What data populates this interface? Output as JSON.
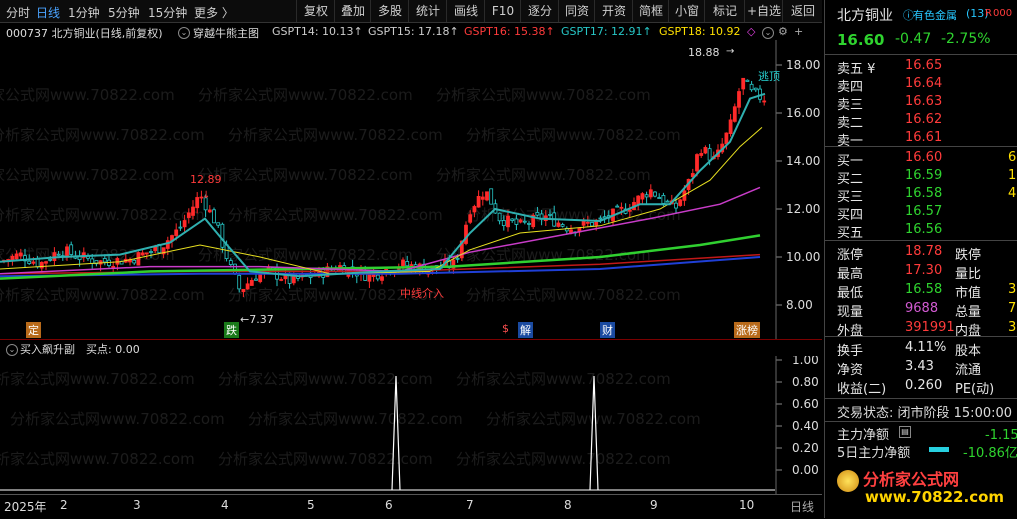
{
  "toolbar": {
    "periods": [
      "分时",
      "日线",
      "1分钟",
      "5分钟",
      "15分钟",
      "更多 〉"
    ],
    "buttons": [
      "复权",
      "叠加",
      "多股",
      "统计",
      "画线",
      "F10",
      "逐分",
      "同资",
      "开资",
      "简框",
      "小窗",
      "标记",
      "+自选",
      "返回"
    ]
  },
  "chart_header": {
    "code_name": "000737 北方铜业(日线,前复权)",
    "indicator": "穿越牛熊主图",
    "gspt": [
      {
        "label": "GSPT14: 10.13↑",
        "color": "#ff3b3b"
      },
      {
        "label": "GSPT15: 17.18↑",
        "color": "#27c7c7"
      },
      {
        "label": "GSPT16: 15.38↑",
        "color": "#ffe000"
      },
      {
        "label": "GSPT17: 12.91↑",
        "color": "#e040e0"
      },
      {
        "label": "GSPT18: 10.92",
        "color": "#2fd42f"
      }
    ]
  },
  "price_axis": {
    "ticks": [
      "18.00",
      "16.00",
      "14.00",
      "12.00",
      "10.00",
      "8.00"
    ]
  },
  "annotations": {
    "high_label": "18.88",
    "peak_label": "12.89",
    "low_label": "←7.37",
    "mid_text": "中线介入",
    "escape_text": "逃顶"
  },
  "event_markers": [
    "定",
    "跌",
    "$",
    "解",
    "财",
    "涨榜"
  ],
  "indicator_panel": {
    "name": "买入飙升副",
    "value_text": "买点: 0.00",
    "ticks": [
      "1.00",
      "0.80",
      "0.60",
      "0.40",
      "0.20",
      "0.00"
    ]
  },
  "x_axis": {
    "labels": [
      "2025年",
      "2",
      "3",
      "4",
      "5",
      "6",
      "7",
      "8",
      "9",
      "10"
    ],
    "corner": "日线"
  },
  "right_panel": {
    "stock_name": "北方铜业",
    "sector": "有色金属",
    "sector_count": "(13)",
    "r_label": "R",
    "level": "000",
    "price": "16.60",
    "change": "-0.47",
    "change_pct": "-2.75%",
    "asks": [
      {
        "label": "卖五 ¥",
        "price": "16.65"
      },
      {
        "label": "卖四",
        "price": "16.64"
      },
      {
        "label": "卖三",
        "price": "16.63"
      },
      {
        "label": "卖二",
        "price": "16.62"
      },
      {
        "label": "卖一",
        "price": "16.61"
      }
    ],
    "bids": [
      {
        "label": "买一",
        "price": "16.60",
        "vol": "6"
      },
      {
        "label": "买二",
        "price": "16.59",
        "vol": "1"
      },
      {
        "label": "买三",
        "price": "16.58",
        "vol": "4"
      },
      {
        "label": "买四",
        "price": "16.57",
        "vol": ""
      },
      {
        "label": "买五",
        "price": "16.56",
        "vol": ""
      }
    ],
    "stats": [
      {
        "l1": "涨停",
        "v1": "18.78",
        "l2": "跌停",
        "v2": ""
      },
      {
        "l1": "最高",
        "v1": "17.30",
        "l2": "量比",
        "v2": ""
      },
      {
        "l1": "最低",
        "v1": "16.58",
        "l2": "市值",
        "v2": "3"
      },
      {
        "l1": "现量",
        "v1": "9688",
        "l2": "总量",
        "v2": "7"
      },
      {
        "l1": "外盘",
        "v1": "391991",
        "l2": "内盘",
        "v2": "3"
      }
    ],
    "fund": [
      {
        "l1": "换手",
        "v1": "4.11%",
        "l2": "股本",
        "v2": ""
      },
      {
        "l1": "净资",
        "v1": "3.43",
        "l2": "流通",
        "v2": ""
      },
      {
        "l1": "收益(二)",
        "v1": "0.260",
        "l2": "PE(动)",
        "v2": ""
      }
    ],
    "trade_status": "交易状态: 闭市阶段 15:00:00",
    "main_net": {
      "label": "主力净额",
      "value": "-1.15亿"
    },
    "main_net5": {
      "label": "5日主力净额",
      "value": "-10.86亿"
    }
  },
  "watermark": {
    "text": "分析家公式网www.70822.com",
    "logo_text": "分析家公式网",
    "logo_url": "www.70822.com"
  }
}
